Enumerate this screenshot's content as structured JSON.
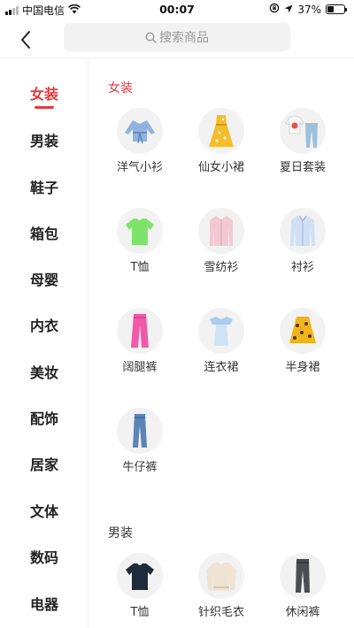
{
  "status_bar": {
    "carrier": "中国电信",
    "time": "00:07",
    "battery": "37%",
    "battery_level": 0.37,
    "icons": [
      "signal-icon",
      "wifi-icon",
      "lock-rotation-icon",
      "location-icon",
      "battery-icon"
    ]
  },
  "nav": {
    "back_icon": "chevron-left-icon",
    "search_icon": "search-icon",
    "search_placeholder": "搜索商品"
  },
  "sidebar": {
    "items": [
      {
        "label": "女装",
        "active": true
      },
      {
        "label": "男装"
      },
      {
        "label": "鞋子"
      },
      {
        "label": "箱包"
      },
      {
        "label": "母婴"
      },
      {
        "label": "内衣"
      },
      {
        "label": "美妆"
      },
      {
        "label": "配饰"
      },
      {
        "label": "居家"
      },
      {
        "label": "文体"
      },
      {
        "label": "数码"
      },
      {
        "label": "电器"
      }
    ]
  },
  "sections": [
    {
      "title": "女装",
      "items": [
        {
          "label": "洋气小衫",
          "icon": "wrap-blouse-icon"
        },
        {
          "label": "仙女小裙",
          "icon": "floral-dress-icon"
        },
        {
          "label": "夏日套装",
          "icon": "summer-set-icon"
        },
        {
          "label": "T恤",
          "icon": "tshirt-icon"
        },
        {
          "label": "雪纺衫",
          "icon": "chiffon-shirt-icon"
        },
        {
          "label": "衬衫",
          "icon": "shirt-icon"
        },
        {
          "label": "阔腿裤",
          "icon": "wide-leg-pants-icon"
        },
        {
          "label": "连衣裙",
          "icon": "dress-icon"
        },
        {
          "label": "半身裙",
          "icon": "skirt-icon"
        },
        {
          "label": "牛仔裤",
          "icon": "jeans-icon"
        }
      ]
    },
    {
      "title": "男装",
      "items": [
        {
          "label": "T恤",
          "icon": "tshirt-icon"
        },
        {
          "label": "针织毛衣",
          "icon": "sweater-icon"
        },
        {
          "label": "休闲裤",
          "icon": "casual-pants-icon"
        }
      ]
    }
  ],
  "colors": {
    "accent": "#e4393c",
    "text": "#222222",
    "muted": "#9a9a9a",
    "search_bg": "#f2f2f2"
  }
}
